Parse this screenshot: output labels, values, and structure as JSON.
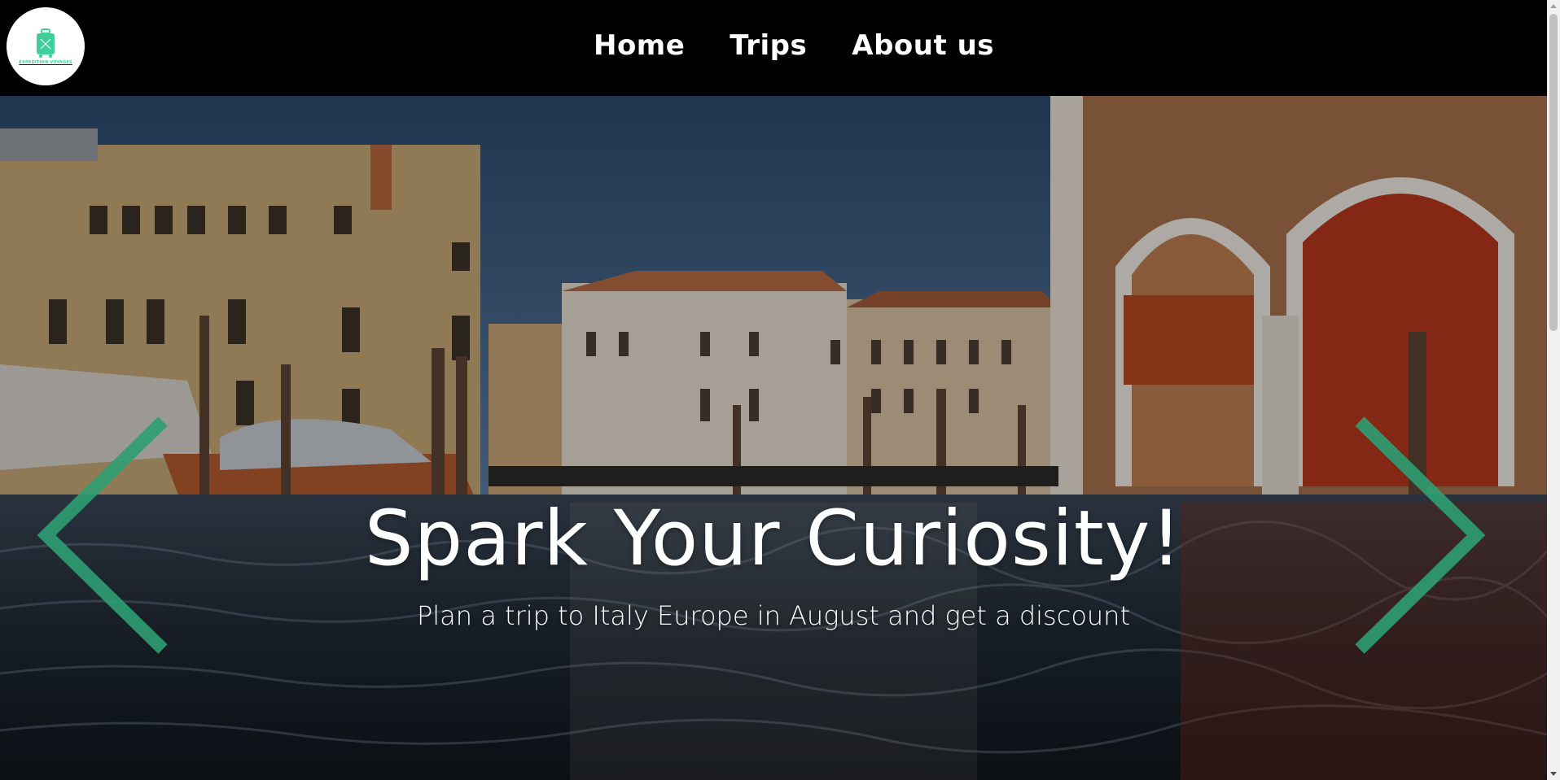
{
  "header": {
    "logo_text": "EXPEDITION VOYAGES",
    "nav": [
      {
        "label": "Home"
      },
      {
        "label": "Trips"
      },
      {
        "label": "About us"
      }
    ]
  },
  "hero": {
    "title": "Spark Your Curiosity!",
    "subtitle": "Plan a trip to Italy Europe in August and get a discount",
    "arrow_color": "#2e9e72",
    "prev_icon": "chevron-left-icon",
    "next_icon": "chevron-right-icon"
  },
  "colors": {
    "header_bg": "#000000",
    "logo_accent": "#3fcf9a",
    "text": "#ffffff"
  }
}
